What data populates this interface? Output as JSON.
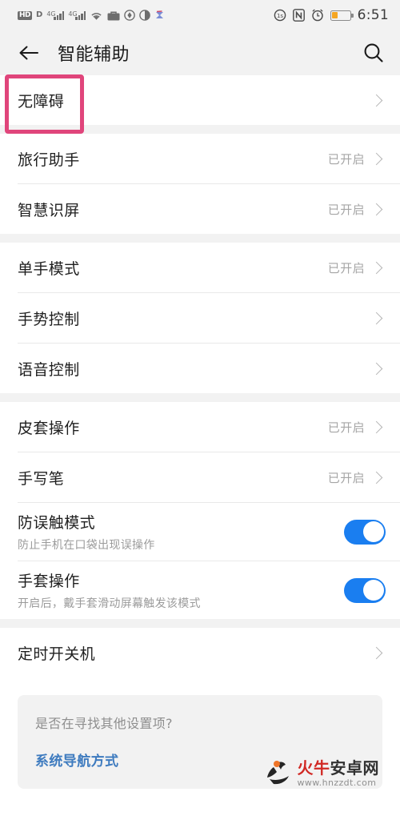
{
  "statusbar": {
    "left_icons": [
      "hd-voice-icon",
      "dual-sim-d-icon",
      "signal-4g-1-icon",
      "signal-4g-2-icon",
      "wifi-icon",
      "briefcase-work-mode-icon",
      "data-saver-icon",
      "do-not-disturb-icon",
      "app-indicator-icon"
    ],
    "hd_label": "HD",
    "sim_label": "D",
    "net_label_1": "4G",
    "net_label_2": "4G",
    "right_icons": [
      "screen-recorder-icon",
      "nfc-icon",
      "alarm-icon",
      "battery-icon"
    ],
    "nfc_label": "N",
    "battery_level_percent": 35,
    "time": "6:51",
    "battery_color": "#f5a623"
  },
  "appbar": {
    "back_icon": "back-arrow-icon",
    "title": "智能辅助",
    "search_icon": "search-icon"
  },
  "highlight": {
    "color": "#e0457b",
    "target": "无障碍"
  },
  "groups": [
    {
      "rows": [
        {
          "label": "无障碍",
          "value": "",
          "type": "chevron"
        }
      ]
    },
    {
      "rows": [
        {
          "label": "旅行助手",
          "value": "已开启",
          "type": "chevron"
        },
        {
          "label": "智慧识屏",
          "value": "已开启",
          "type": "chevron"
        }
      ]
    },
    {
      "rows": [
        {
          "label": "单手模式",
          "value": "已开启",
          "type": "chevron"
        },
        {
          "label": "手势控制",
          "value": "",
          "type": "chevron"
        },
        {
          "label": "语音控制",
          "value": "",
          "type": "chevron"
        }
      ]
    },
    {
      "rows": [
        {
          "label": "皮套操作",
          "value": "已开启",
          "type": "chevron"
        },
        {
          "label": "手写笔",
          "value": "已开启",
          "type": "chevron"
        },
        {
          "label": "防误触模式",
          "sub": "防止手机在口袋出现误操作",
          "value": "",
          "type": "toggle",
          "on": true
        },
        {
          "label": "手套操作",
          "sub": "开启后，戴手套滑动屏幕触发该模式",
          "value": "",
          "type": "toggle",
          "on": true
        }
      ]
    },
    {
      "rows": [
        {
          "label": "定时开关机",
          "value": "",
          "type": "chevron"
        }
      ]
    }
  ],
  "footer": {
    "question": "是否在寻找其他设置项?",
    "link": "系统导航方式",
    "link_color": "#3e7bbf"
  },
  "watermark": {
    "brand_red": "火牛",
    "brand_dark": "安卓网",
    "url": "www.hnzzdt.com"
  }
}
